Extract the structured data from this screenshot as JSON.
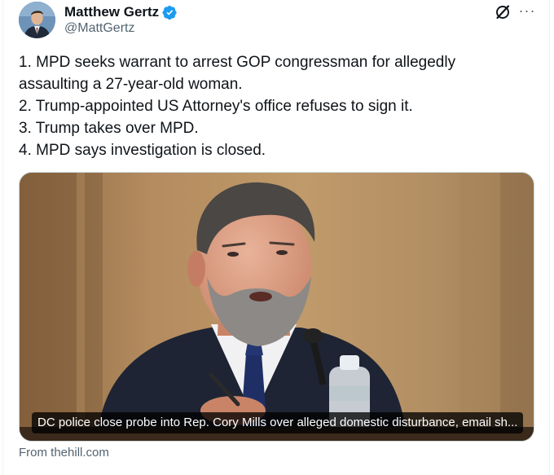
{
  "author": {
    "name": "Matthew Gertz",
    "handle": "@MattGertz",
    "verified": true
  },
  "header_icons": [
    "grok-icon",
    "more-icon"
  ],
  "more_label": "···",
  "tweet": {
    "lines": [
      "1. MPD seeks warrant to arrest GOP congressman for allegedly",
      "assaulting a 27-year-old woman.",
      "2. Trump-appointed US Attorney's office refuses to sign it.",
      "3. Trump takes over MPD.",
      "4. MPD says investigation is closed."
    ]
  },
  "card": {
    "caption": "DC police close probe into Rep. Cory Mills over alleged domestic disturbance, email sh...",
    "source": "From thehill.com"
  },
  "colors": {
    "text": "#0f1419",
    "secondary": "#536471",
    "verified_blue": "#1d9bf0",
    "border": "#cfd9de"
  }
}
